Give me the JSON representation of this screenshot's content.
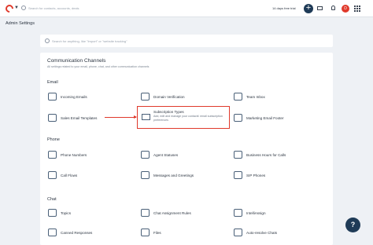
{
  "topbar": {
    "search_placeholder": "Search for contacts, accounts, deals",
    "trial_text": "14 days free trial",
    "plus_label": "+",
    "avatar_initial": "D"
  },
  "page": {
    "title": "Admin Settings",
    "search_placeholder": "Search for anything, like \"Import\" or \"website tracking\""
  },
  "card": {
    "title": "Communication Channels",
    "subtitle": "All settings related to your email, phone, chat, and other communication channels",
    "sections": {
      "email": {
        "title": "Email",
        "items": [
          "Incoming Emails",
          "Domain Verification",
          "Team Inbox",
          "Sales Email Templates",
          "Subscription Types",
          "Marketing Email Footer"
        ],
        "highlight_desc": "Add, edit and manage your contacts' email subscription preferences"
      },
      "phone": {
        "title": "Phone",
        "items": [
          "Phone Numbers",
          "Agent Statuses",
          "Business Hours for Calls",
          "Call Flows",
          "Messages and Greetings",
          "SIP Phones"
        ]
      },
      "chat": {
        "title": "Chat",
        "items": [
          "Topics",
          "Chat Assignment Rules",
          "IntelliAssign",
          "Canned Responses",
          "Files",
          "Auto-resolve Chats"
        ]
      }
    }
  },
  "help": {
    "label": "?"
  },
  "colors": {
    "accent": "#e0392b",
    "nav": "#1f3b57"
  }
}
